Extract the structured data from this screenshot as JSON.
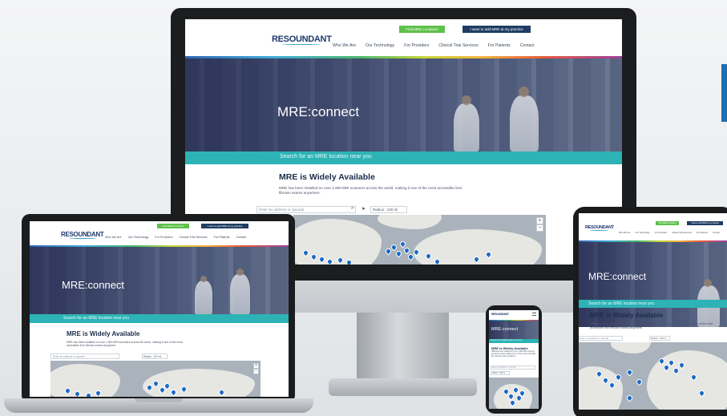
{
  "brand": {
    "logo_text": "RESOUNDANT"
  },
  "header": {
    "btn_find": "Find MRE Locations",
    "btn_add": "I want to add MRE at my practice",
    "nav": [
      "Who We Are",
      "Our Technology",
      "For Providers",
      "Clinical Trial Services",
      "For Patients",
      "Contact"
    ]
  },
  "hero": {
    "title": "MRE:connect"
  },
  "search_bar": {
    "text": "Search for an MRE location near you"
  },
  "section": {
    "title": "MRE is Widely Available",
    "body": "MRE has been installed on over 1,800 MRI scanners across the world, making it one of the most accessible liver fibrosis exams anywhere."
  },
  "search": {
    "placeholder": "Enter an address or zipcode",
    "radius": "Radius : 100 mi",
    "search_icon": "search-icon",
    "locate_icon": "location-arrow-icon"
  },
  "map": {
    "zoom_in": "+",
    "zoom_out": "−"
  },
  "colors": {
    "green_button": "#5ec14a",
    "navy_button": "#1f3d63",
    "teal_bar": "#2db3b5",
    "pin": "#1b69c7",
    "logo": "#1d3a6b"
  }
}
